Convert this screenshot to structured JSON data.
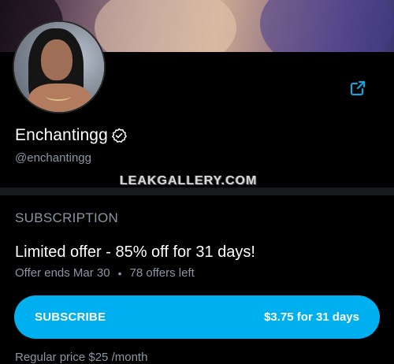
{
  "profile": {
    "name": "Enchantingg",
    "handle": "@enchantingg",
    "verified": true
  },
  "watermark": "LEAKGALLERY.COM",
  "subscription": {
    "section_title": "SUBSCRIPTION",
    "offer_title": "Limited offer - 85% off for 31 days!",
    "offer_ends": "Offer ends Mar 30",
    "separator": "•",
    "offers_left": "78 offers left",
    "button_label": "SUBSCRIBE",
    "button_price": "$3.75 for 31 days",
    "regular_price": "Regular price $25 /month"
  },
  "icons": {
    "share": "share-icon",
    "verified": "verified-badge-icon"
  },
  "colors": {
    "accent": "#00aff0",
    "muted_text": "#8a96a3",
    "background": "#000000"
  }
}
